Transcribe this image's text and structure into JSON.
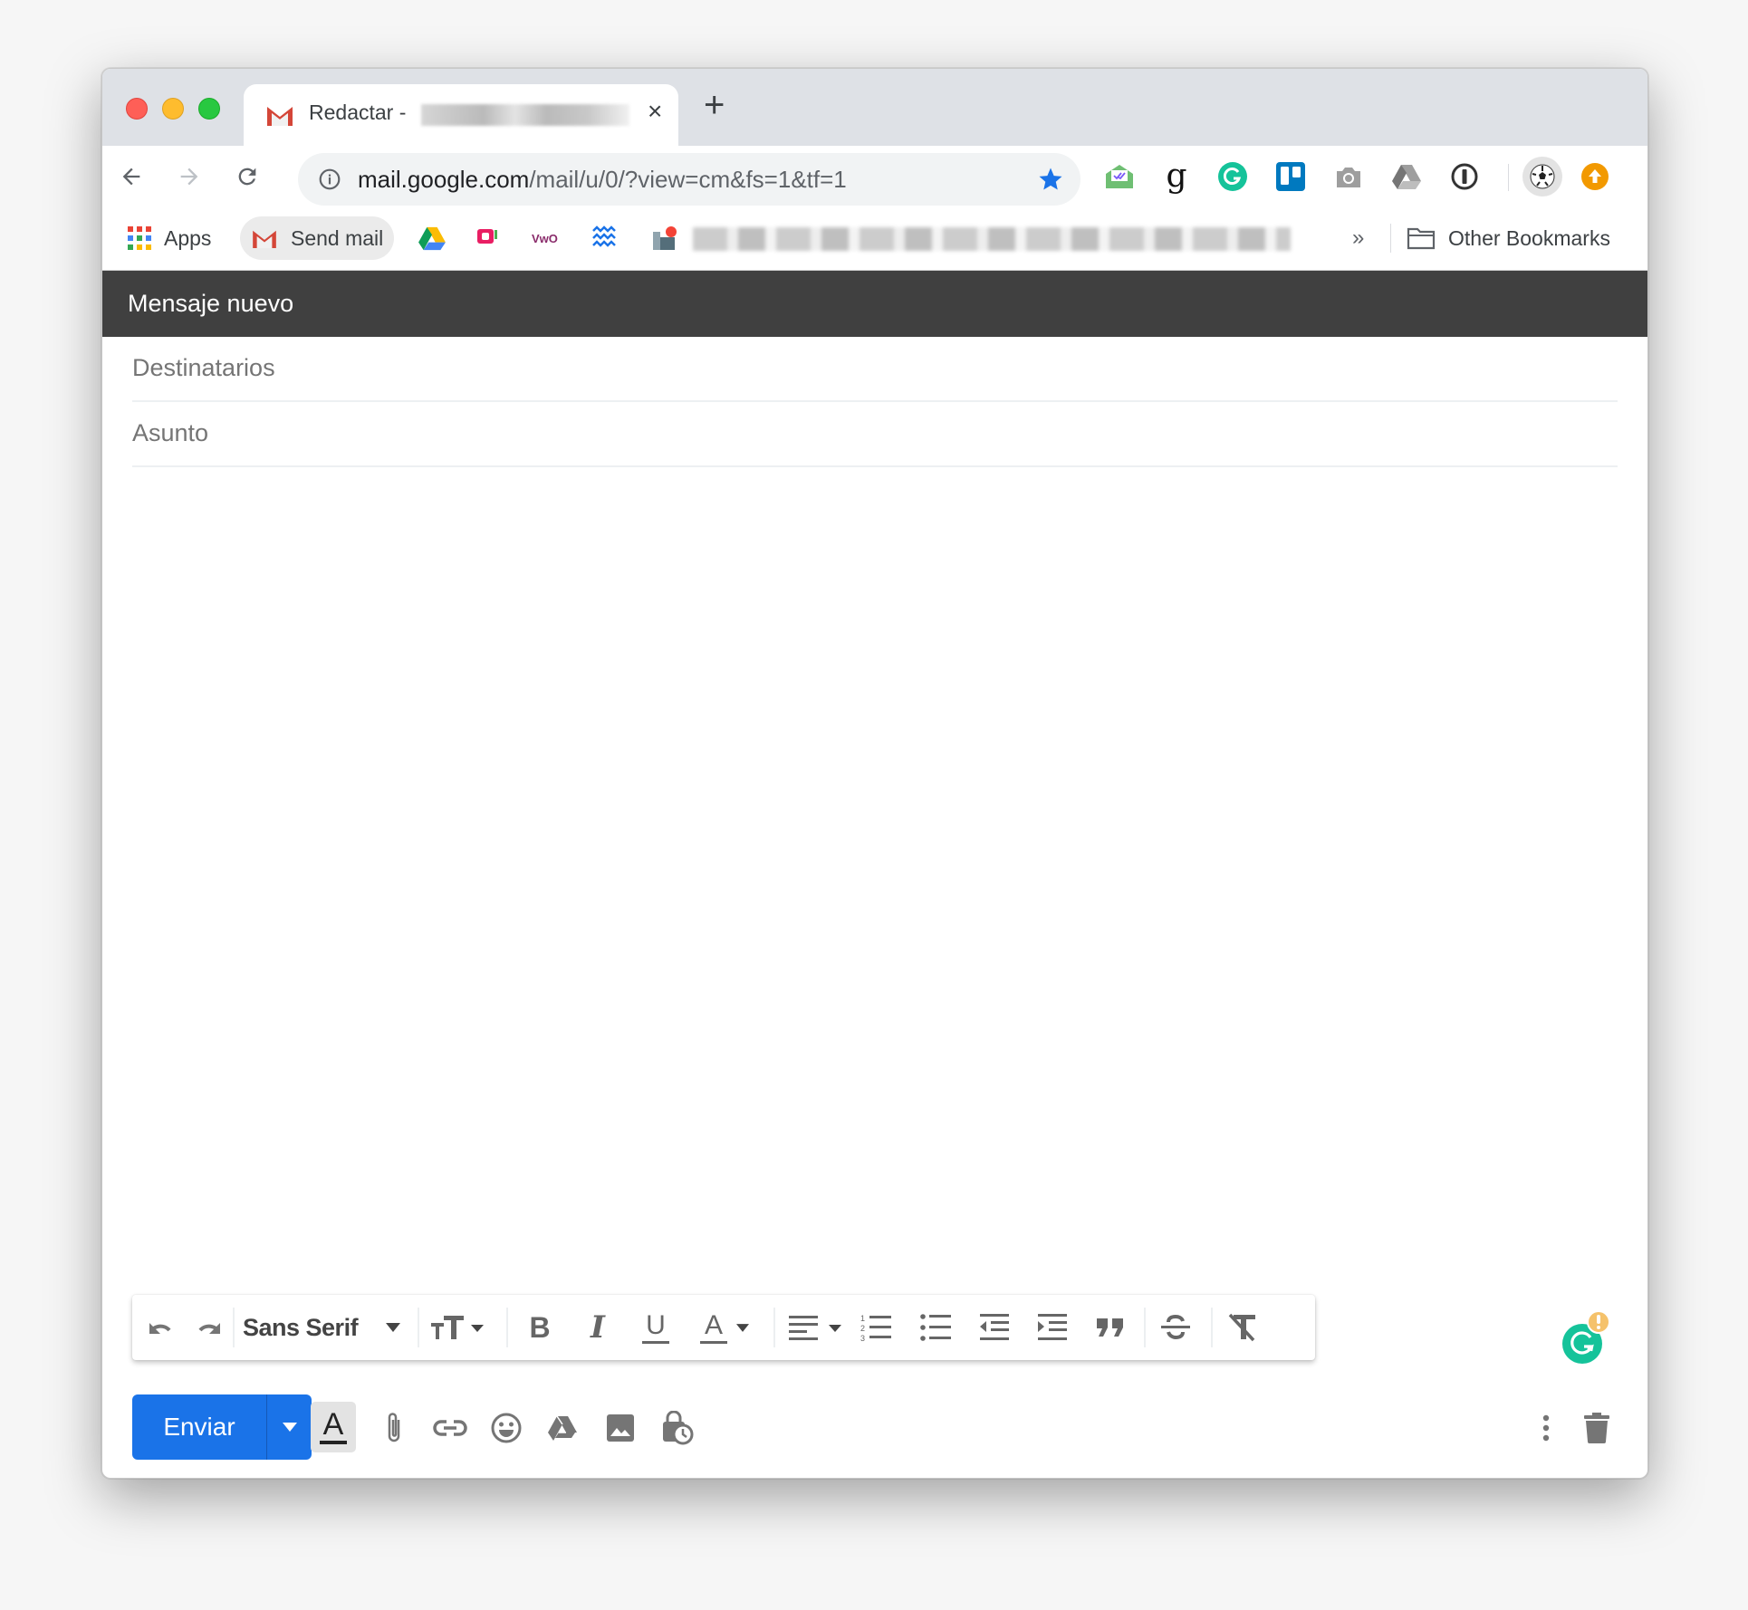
{
  "window": {
    "traffic_lights": [
      "close",
      "minimize",
      "zoom"
    ]
  },
  "tab": {
    "favicon": "gmail-icon",
    "title": "Redactar -",
    "close_label": "×",
    "new_tab_label": "+"
  },
  "toolbar": {
    "url_host": "mail.google.com",
    "url_path": "/mail/u/0/?view=cm&fs=1&tf=1",
    "extensions": [
      "mailtrack-icon",
      "goodreads-icon",
      "grammarly-icon",
      "trello-icon",
      "camera-icon",
      "google-drive-icon",
      "1password-icon",
      "soccer-ball-avatar-icon",
      "upload-arrow-icon"
    ]
  },
  "bookmarks": {
    "apps_label": "Apps",
    "send_mail_label": "Send mail",
    "icons": [
      "google-drive-icon",
      "chat-bubble-icon",
      "vwo-icon",
      "waves-icon",
      "notification-icon"
    ],
    "more_label": "»",
    "other_label": "Other Bookmarks"
  },
  "compose": {
    "title": "Mensaje nuevo",
    "to_placeholder": "Destinatarios",
    "subject_placeholder": "Asunto",
    "to_value": "",
    "subject_value": "",
    "body_value": ""
  },
  "format_bar": {
    "font": "Sans Serif",
    "buttons": [
      "undo",
      "redo",
      "font",
      "text-size",
      "bold",
      "italic",
      "underline",
      "text-color",
      "align",
      "numbered-list",
      "bulleted-list",
      "indent-less",
      "indent-more",
      "quote",
      "strikethrough",
      "remove-formatting"
    ]
  },
  "bottom_bar": {
    "send_label": "Enviar",
    "tools": [
      "formatting-options",
      "attach-files",
      "insert-link",
      "insert-emoji",
      "insert-drive-file",
      "insert-photo",
      "confidential-mode",
      "more-options",
      "discard-draft"
    ]
  },
  "colors": {
    "send_blue": "#1a73e8",
    "compose_header": "#404040",
    "grammarly_green": "#15c39a",
    "star_blue": "#1a73e8"
  }
}
